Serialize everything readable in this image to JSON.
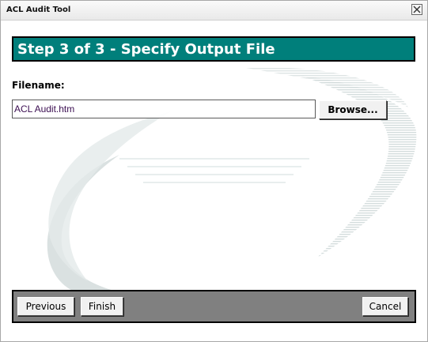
{
  "window": {
    "title": "ACL Audit Tool",
    "close_icon": "close-x-icon"
  },
  "header": {
    "title": "Step 3 of 3 - Specify Output File",
    "accent_color": "#007f7b"
  },
  "form": {
    "filename_label": "Filename:",
    "filename_value": "ACL Audit.htm",
    "browse_label": "Browse..."
  },
  "footer": {
    "previous_label": "Previous",
    "finish_label": "Finish",
    "cancel_label": "Cancel",
    "bar_color": "#808080"
  }
}
